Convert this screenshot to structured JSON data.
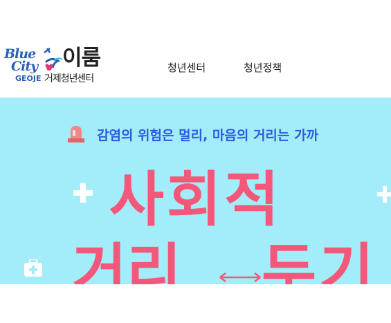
{
  "logo": {
    "blue": "Blue",
    "city": "City",
    "geoje": "GEOJE",
    "name": "이룸",
    "subtitle": "거제청년센터"
  },
  "nav": {
    "items": [
      {
        "label": "청년센터"
      },
      {
        "label": "청년정책"
      }
    ]
  },
  "banner": {
    "tagline": "감염의 위험은 멀리, 마음의 거리는 가까",
    "title_line1": "사회적",
    "title_line2_left": "거리",
    "title_line2_right": "두기",
    "colors": {
      "background": "#a3ecf9",
      "tagline": "#2d5be3",
      "title": "#f3587a"
    }
  }
}
